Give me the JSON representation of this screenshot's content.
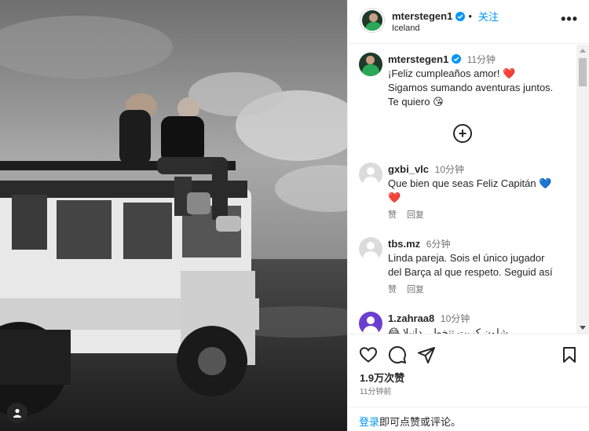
{
  "post": {
    "username": "mterstegen1",
    "follow_label": "关注",
    "separator": "•",
    "location": "Iceland",
    "more_label": "•••"
  },
  "caption": {
    "username": "mterstegen1",
    "time": "11分钟",
    "line1": "¡Feliz cumpleaños amor! ❤️",
    "line2": "Sigamos sumando aventuras juntos.",
    "line3": "Te quiero 😘"
  },
  "load_more_label": "+",
  "comments": [
    {
      "username": "gxbi_vlc",
      "time": "10分钟",
      "line1": "Que bien que seas Feliz Capitán 💙",
      "line2": "❤️",
      "like_label": "赞",
      "reply_label": "回复"
    },
    {
      "username": "tbs.mz",
      "time": "6分钟",
      "line1": "Linda pareja. Sois el único jugador",
      "line2": "del Barça al que respeto. Seguid así",
      "like_label": "赞",
      "reply_label": "回复"
    },
    {
      "username": "1.zahraa8",
      "time": "10分钟",
      "line1": "😂 شلون كريت تتخطى دانيلا"
    }
  ],
  "footer": {
    "likes": "1.9万次赞",
    "time_ago": "11分钟前",
    "login_link": "登录",
    "login_rest": "即可点赞或评论。"
  },
  "icons": {
    "like": "heart-icon",
    "comment": "comment-icon",
    "share": "share-icon",
    "save": "bookmark-icon",
    "tag": "user-tag-icon"
  }
}
